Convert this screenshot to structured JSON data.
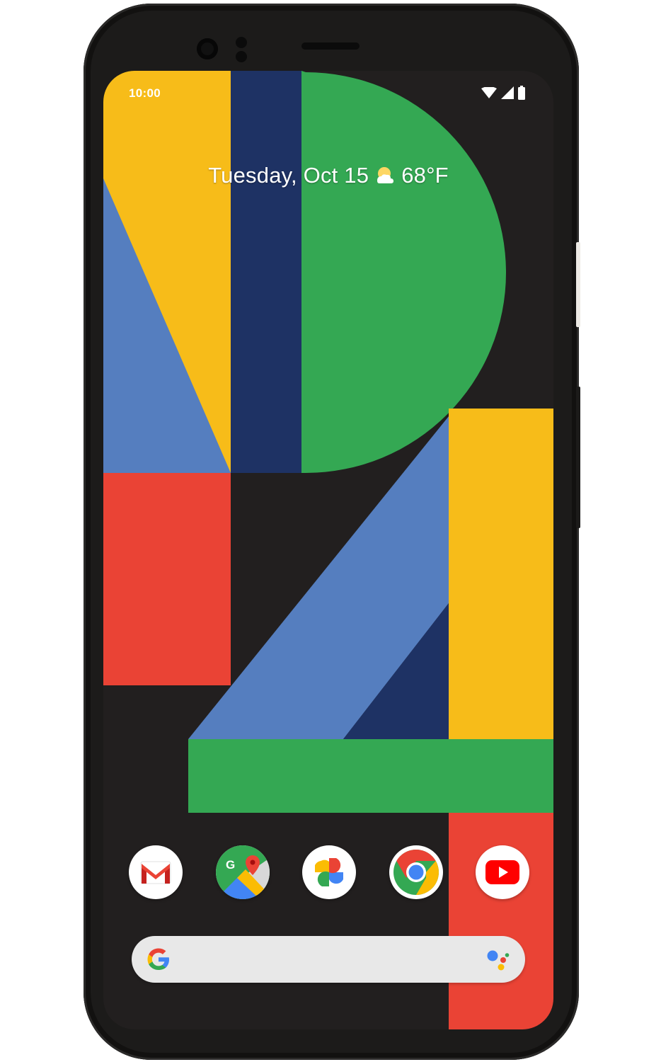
{
  "status_bar": {
    "time": "10:00",
    "icons": [
      "wifi-icon",
      "signal-icon",
      "battery-icon"
    ]
  },
  "at_a_glance": {
    "date": "Tuesday, Oct 15",
    "weather_icon": "partly-sunny-icon",
    "temperature": "68°F"
  },
  "dock": {
    "apps": [
      "Gmail",
      "Maps",
      "Photos",
      "Chrome",
      "YouTube"
    ]
  },
  "search_bar": {
    "left_icon": "google-g-icon",
    "right_icon": "google-assistant-icon"
  },
  "colors": {
    "yellow": "#F7BC19",
    "navy": "#1E3264",
    "green": "#34A853",
    "blue": "#557EBF",
    "red": "#EA4335",
    "background": "#221F1F",
    "phone_body": "#1C1B1A"
  }
}
